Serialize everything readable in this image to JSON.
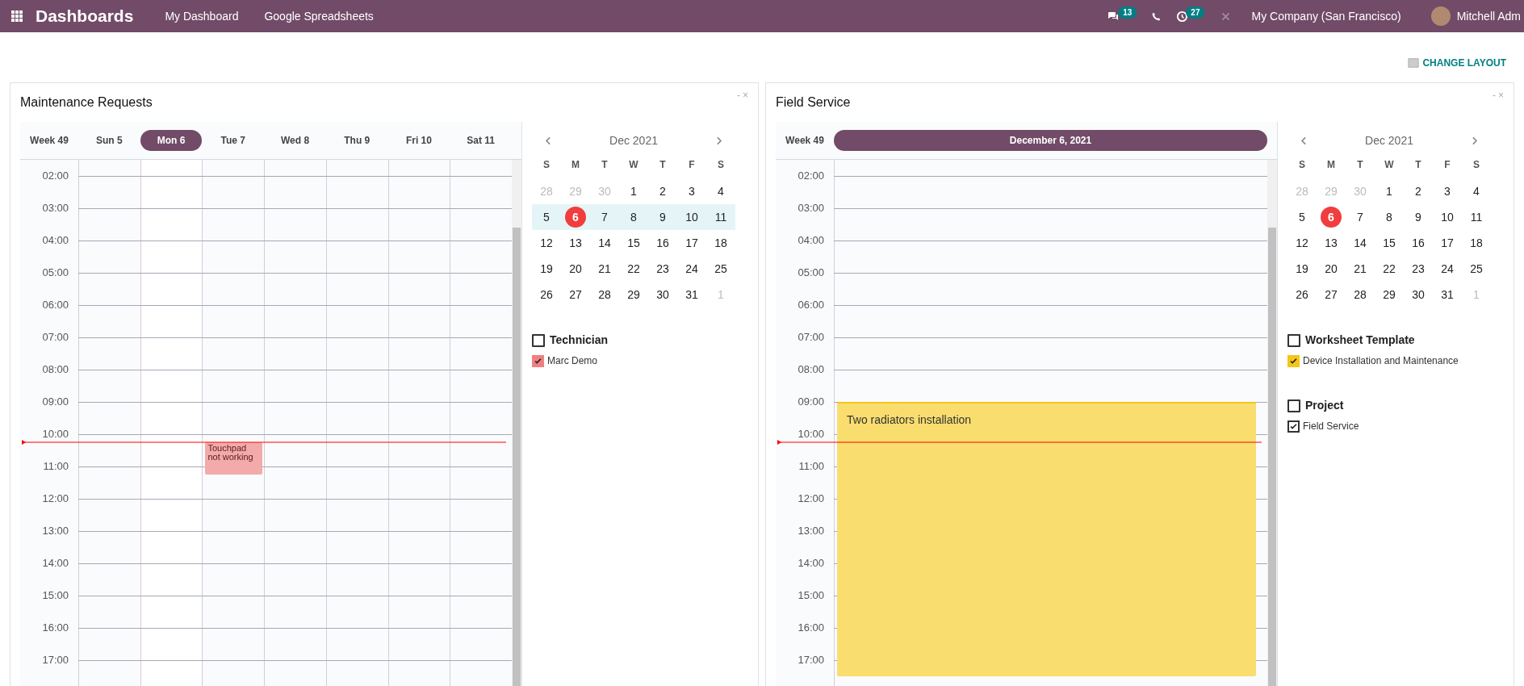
{
  "topbar": {
    "app_title": "Dashboards",
    "menu": [
      "My Dashboard",
      "Google Spreadsheets"
    ],
    "chat_count": "13",
    "activity_count": "27",
    "company": "My Company (San Francisco)",
    "user": "Mitchell Adm"
  },
  "change_layout": "CHANGE LAYOUT",
  "panels": [
    {
      "title": "Maintenance Requests",
      "controls": [
        "-",
        "×"
      ],
      "kind": "week",
      "week_label": "Week 49",
      "days": [
        {
          "label": "Sun 5",
          "selected": false
        },
        {
          "label": "Mon 6",
          "selected": true
        },
        {
          "label": "Tue 7",
          "selected": false,
          "events": [
            {
              "title": "Touchpad not working",
              "color": "#f3aaaa",
              "kind": "short"
            }
          ]
        },
        {
          "label": "Wed 8",
          "selected": false
        },
        {
          "label": "Thu 9",
          "selected": false
        },
        {
          "label": "Fri 10",
          "selected": false
        },
        {
          "label": "Sat 11",
          "selected": false
        }
      ],
      "hours": [
        {
          "label": "02:00",
          "now": false,
          "event_start": false
        },
        {
          "label": "03:00",
          "now": false,
          "event_start": false
        },
        {
          "label": "04:00",
          "now": false,
          "event_start": false
        },
        {
          "label": "05:00",
          "now": false,
          "event_start": false
        },
        {
          "label": "06:00",
          "now": false,
          "event_start": false
        },
        {
          "label": "07:00",
          "now": false,
          "event_start": false
        },
        {
          "label": "08:00",
          "now": false,
          "event_start": false
        },
        {
          "label": "09:00",
          "now": false,
          "event_start": false
        },
        {
          "label": "10:00",
          "now": true,
          "event_start": true
        },
        {
          "label": "11:00",
          "now": false,
          "event_start": false
        },
        {
          "label": "12:00",
          "now": false,
          "event_start": false
        },
        {
          "label": "13:00",
          "now": false,
          "event_start": false
        },
        {
          "label": "14:00",
          "now": false,
          "event_start": false
        },
        {
          "label": "15:00",
          "now": false,
          "event_start": false
        },
        {
          "label": "16:00",
          "now": false,
          "event_start": false
        },
        {
          "label": "17:00",
          "now": false,
          "event_start": false
        }
      ],
      "minical": {
        "month": "Dec 2021",
        "weekdays": [
          "S",
          "M",
          "T",
          "W",
          "T",
          "F",
          "S"
        ],
        "weeks": [
          {
            "selected": false,
            "days": [
              {
                "label": "28",
                "muted": true,
                "today": false
              },
              {
                "label": "29",
                "muted": true,
                "today": false
              },
              {
                "label": "30",
                "muted": true,
                "today": false
              },
              {
                "label": "1",
                "muted": false,
                "today": false
              },
              {
                "label": "2",
                "muted": false,
                "today": false
              },
              {
                "label": "3",
                "muted": false,
                "today": false
              },
              {
                "label": "4",
                "muted": false,
                "today": false
              }
            ]
          },
          {
            "selected": true,
            "days": [
              {
                "label": "5",
                "muted": false,
                "today": false
              },
              {
                "label": "6",
                "muted": false,
                "today": true
              },
              {
                "label": "7",
                "muted": false,
                "today": false
              },
              {
                "label": "8",
                "muted": false,
                "today": false
              },
              {
                "label": "9",
                "muted": false,
                "today": false
              },
              {
                "label": "10",
                "muted": false,
                "today": false
              },
              {
                "label": "11",
                "muted": false,
                "today": false
              }
            ]
          },
          {
            "selected": false,
            "days": [
              {
                "label": "12",
                "muted": false,
                "today": false
              },
              {
                "label": "13",
                "muted": false,
                "today": false
              },
              {
                "label": "14",
                "muted": false,
                "today": false
              },
              {
                "label": "15",
                "muted": false,
                "today": false
              },
              {
                "label": "16",
                "muted": false,
                "today": false
              },
              {
                "label": "17",
                "muted": false,
                "today": false
              },
              {
                "label": "18",
                "muted": false,
                "today": false
              }
            ]
          },
          {
            "selected": false,
            "days": [
              {
                "label": "19",
                "muted": false,
                "today": false
              },
              {
                "label": "20",
                "muted": false,
                "today": false
              },
              {
                "label": "21",
                "muted": false,
                "today": false
              },
              {
                "label": "22",
                "muted": false,
                "today": false
              },
              {
                "label": "23",
                "muted": false,
                "today": false
              },
              {
                "label": "24",
                "muted": false,
                "today": false
              },
              {
                "label": "25",
                "muted": false,
                "today": false
              }
            ]
          },
          {
            "selected": false,
            "days": [
              {
                "label": "26",
                "muted": false,
                "today": false
              },
              {
                "label": "27",
                "muted": false,
                "today": false
              },
              {
                "label": "28",
                "muted": false,
                "today": false
              },
              {
                "label": "29",
                "muted": false,
                "today": false
              },
              {
                "label": "30",
                "muted": false,
                "today": false
              },
              {
                "label": "31",
                "muted": false,
                "today": false
              },
              {
                "label": "1",
                "muted": true,
                "today": false
              }
            ]
          }
        ]
      },
      "filters": [
        {
          "label": "Technician",
          "checked": false,
          "items": [
            {
              "label": "Marc Demo",
              "checked": true,
              "color": "#f08080"
            }
          ]
        }
      ]
    },
    {
      "title": "Field Service",
      "controls": [
        "-",
        "×"
      ],
      "kind": "day",
      "week_label": "Week 49",
      "days": [
        {
          "label": "December 6, 2021",
          "selected": true,
          "events": [
            {
              "title": "Two radiators installation",
              "color": "#f9de6f",
              "kind": "long"
            }
          ]
        }
      ],
      "hours": [
        {
          "label": "02:00",
          "now": false,
          "event_start": false
        },
        {
          "label": "03:00",
          "now": false,
          "event_start": false
        },
        {
          "label": "04:00",
          "now": false,
          "event_start": false
        },
        {
          "label": "05:00",
          "now": false,
          "event_start": false
        },
        {
          "label": "06:00",
          "now": false,
          "event_start": false
        },
        {
          "label": "07:00",
          "now": false,
          "event_start": false
        },
        {
          "label": "08:00",
          "now": false,
          "event_start": false
        },
        {
          "label": "09:00",
          "now": false,
          "event_start": true
        },
        {
          "label": "10:00",
          "now": true,
          "event_start": false
        },
        {
          "label": "11:00",
          "now": false,
          "event_start": false
        },
        {
          "label": "12:00",
          "now": false,
          "event_start": false
        },
        {
          "label": "13:00",
          "now": false,
          "event_start": false
        },
        {
          "label": "14:00",
          "now": false,
          "event_start": false
        },
        {
          "label": "15:00",
          "now": false,
          "event_start": false
        },
        {
          "label": "16:00",
          "now": false,
          "event_start": false
        },
        {
          "label": "17:00",
          "now": false,
          "event_start": false
        }
      ],
      "minical": {
        "month": "Dec 2021",
        "weekdays": [
          "S",
          "M",
          "T",
          "W",
          "T",
          "F",
          "S"
        ],
        "weeks": [
          {
            "selected": false,
            "days": [
              {
                "label": "28",
                "muted": true,
                "today": false
              },
              {
                "label": "29",
                "muted": true,
                "today": false
              },
              {
                "label": "30",
                "muted": true,
                "today": false
              },
              {
                "label": "1",
                "muted": false,
                "today": false
              },
              {
                "label": "2",
                "muted": false,
                "today": false
              },
              {
                "label": "3",
                "muted": false,
                "today": false
              },
              {
                "label": "4",
                "muted": false,
                "today": false
              }
            ]
          },
          {
            "selected": false,
            "days": [
              {
                "label": "5",
                "muted": false,
                "today": false
              },
              {
                "label": "6",
                "muted": false,
                "today": true
              },
              {
                "label": "7",
                "muted": false,
                "today": false
              },
              {
                "label": "8",
                "muted": false,
                "today": false
              },
              {
                "label": "9",
                "muted": false,
                "today": false
              },
              {
                "label": "10",
                "muted": false,
                "today": false
              },
              {
                "label": "11",
                "muted": false,
                "today": false
              }
            ]
          },
          {
            "selected": false,
            "days": [
              {
                "label": "12",
                "muted": false,
                "today": false
              },
              {
                "label": "13",
                "muted": false,
                "today": false
              },
              {
                "label": "14",
                "muted": false,
                "today": false
              },
              {
                "label": "15",
                "muted": false,
                "today": false
              },
              {
                "label": "16",
                "muted": false,
                "today": false
              },
              {
                "label": "17",
                "muted": false,
                "today": false
              },
              {
                "label": "18",
                "muted": false,
                "today": false
              }
            ]
          },
          {
            "selected": false,
            "days": [
              {
                "label": "19",
                "muted": false,
                "today": false
              },
              {
                "label": "20",
                "muted": false,
                "today": false
              },
              {
                "label": "21",
                "muted": false,
                "today": false
              },
              {
                "label": "22",
                "muted": false,
                "today": false
              },
              {
                "label": "23",
                "muted": false,
                "today": false
              },
              {
                "label": "24",
                "muted": false,
                "today": false
              },
              {
                "label": "25",
                "muted": false,
                "today": false
              }
            ]
          },
          {
            "selected": false,
            "days": [
              {
                "label": "26",
                "muted": false,
                "today": false
              },
              {
                "label": "27",
                "muted": false,
                "today": false
              },
              {
                "label": "28",
                "muted": false,
                "today": false
              },
              {
                "label": "29",
                "muted": false,
                "today": false
              },
              {
                "label": "30",
                "muted": false,
                "today": false
              },
              {
                "label": "31",
                "muted": false,
                "today": false
              },
              {
                "label": "1",
                "muted": true,
                "today": false
              }
            ]
          }
        ]
      },
      "filters": [
        {
          "label": "Worksheet Template",
          "checked": false,
          "items": [
            {
              "label": "Device Installation and Maintenance",
              "checked": true,
              "color": "#f5c518"
            }
          ]
        },
        {
          "label": "Project",
          "checked": false,
          "items": [
            {
              "label": "Field Service",
              "checked": true
            }
          ]
        }
      ]
    }
  ]
}
